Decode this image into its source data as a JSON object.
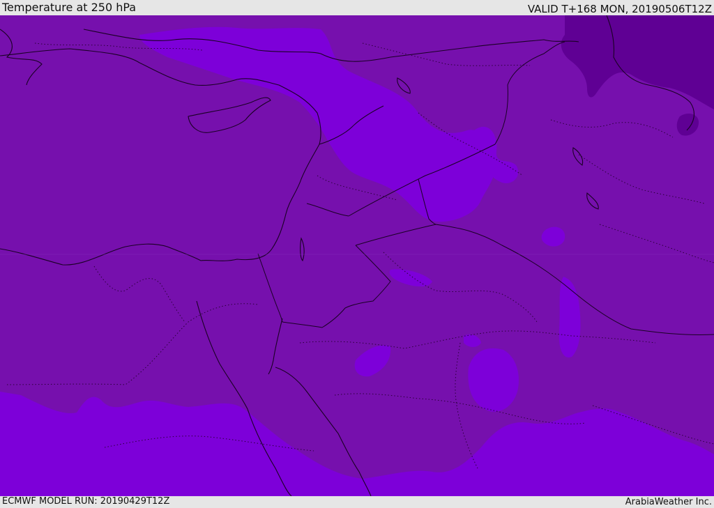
{
  "header": {
    "title": "Temperature at 250 hPa",
    "valid": "VALID T+168 MON, 20190506T12Z"
  },
  "footer": {
    "model_run": "ECMWF MODEL RUN: 20190429T12Z",
    "credit": "ArabiaWeather Inc."
  },
  "colors": {
    "base_fill": "#7610ad",
    "warm_fill": "#7d00d9",
    "cold_fill": "#5f0094",
    "border_line": "#1a0024",
    "province_line": "#2a0038"
  },
  "map": {
    "variable": "temperature",
    "level": "250 hPa",
    "layers": [
      "temperature-shading",
      "coastlines",
      "country-borders",
      "province-borders"
    ]
  }
}
